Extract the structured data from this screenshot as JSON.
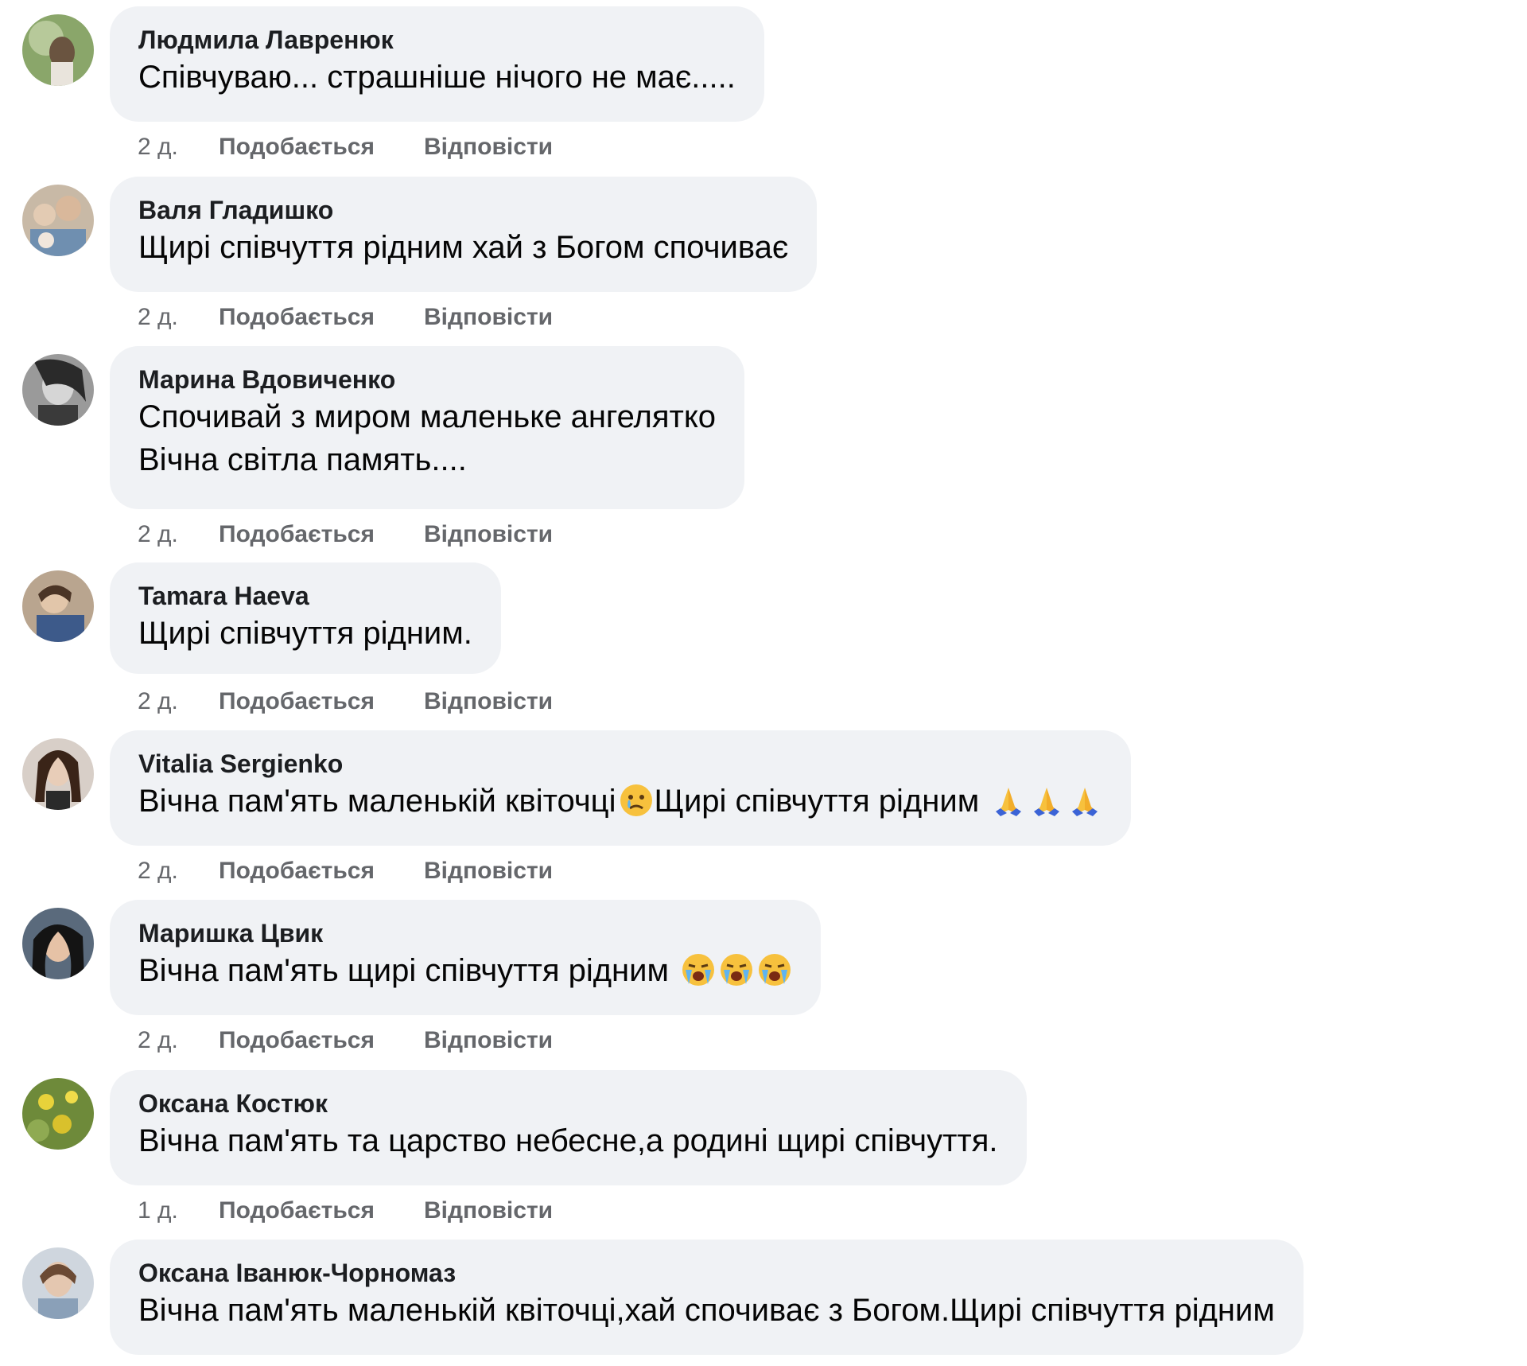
{
  "comments": [
    {
      "author": "Людмила Лавренюк",
      "text": "Співчуваю... страшніше нічого не має.....",
      "time": "2 д.",
      "like_label": "Подобається",
      "reply_label": "Відповісти",
      "emoji": []
    },
    {
      "author": "Валя Гладишко",
      "text": "Щирі співчуття рідним хай з Богом спочиває",
      "time": "2 д.",
      "like_label": "Подобається",
      "reply_label": "Відповісти",
      "emoji": []
    },
    {
      "author": "Марина Вдовиченко",
      "text": "Спочивай з миром маленьке ангелятко\nВічна світла память....",
      "time": "2 д.",
      "like_label": "Подобається",
      "reply_label": "Відповісти",
      "emoji": []
    },
    {
      "author": "Tamara Haeva",
      "text": "Щирі співчуття рідним.",
      "time": "2 д.",
      "like_label": "Подобається",
      "reply_label": "Відповісти",
      "emoji": []
    },
    {
      "author": "Vitalia Sergienko",
      "text_before": "Вічна пам'ять маленькій квіточці",
      "text_after": "Щирі співчуття рідним ",
      "time": "2 д.",
      "like_label": "Подобається",
      "reply_label": "Відповісти",
      "emoji_inline": [
        "crying-face-emoji"
      ],
      "emoji": [
        "folded-hands-emoji",
        "folded-hands-emoji",
        "folded-hands-emoji"
      ]
    },
    {
      "author": "Маришка Цвик",
      "text": "Вічна пам'ять щирі співчуття рідним ",
      "time": "2 д.",
      "like_label": "Подобається",
      "reply_label": "Відповісти",
      "emoji": [
        "loudly-crying-face-emoji",
        "loudly-crying-face-emoji",
        "loudly-crying-face-emoji"
      ]
    },
    {
      "author": "Оксана Костюк",
      "text": "Вічна пам'ять та царство небесне,а родині щирі співчуття.",
      "time": "1 д.",
      "like_label": "Подобається",
      "reply_label": "Відповісти",
      "emoji": []
    },
    {
      "author": "Оксана Іванюк-Чорномаз",
      "text": "Вічна пам'ять маленькій квіточці,хай спочиває з Богом.Щирі співчуття рідним",
      "time": "",
      "like_label": "",
      "reply_label": "",
      "emoji": []
    }
  ],
  "colors": {
    "bubble_bg": "#f0f2f5",
    "meta_text": "#65676b",
    "body_text": "#050505"
  }
}
